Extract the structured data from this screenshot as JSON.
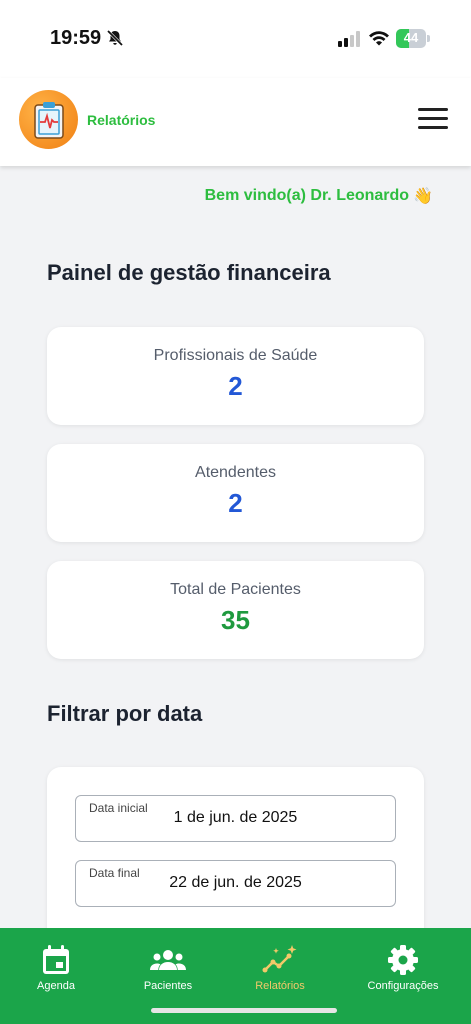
{
  "status_bar": {
    "time": "19:59",
    "battery": "44",
    "battery_level": 0.44
  },
  "header": {
    "title": "Relatórios"
  },
  "welcome": {
    "text": "Bem vindo(a) Dr. Leonardo",
    "emoji": "👋"
  },
  "dashboard": {
    "title": "Painel de gestão financeira",
    "stats": [
      {
        "label": "Profissionais de Saúde",
        "value": "2",
        "color": "#2358d6"
      },
      {
        "label": "Atendentes",
        "value": "2",
        "color": "#2358d6"
      },
      {
        "label": "Total de Pacientes",
        "value": "35",
        "color": "#1f9a3f"
      }
    ]
  },
  "filter": {
    "title": "Filtrar por data",
    "start_label": "Data inicial",
    "start_value": "1 de jun. de 2025",
    "end_label": "Data final",
    "end_value": "22 de jun. de 2025"
  },
  "nav": {
    "items": [
      {
        "label": "Agenda",
        "icon": "calendar-icon"
      },
      {
        "label": "Pacientes",
        "icon": "people-icon"
      },
      {
        "label": "Relatórios",
        "icon": "chart-sparkle-icon",
        "active": true
      },
      {
        "label": "Configurações",
        "icon": "gear-icon"
      }
    ]
  },
  "colors": {
    "accent_green": "#2dbd3f",
    "nav_background": "#1ba54a",
    "nav_active": "#f3c969",
    "stat_blue": "#2358d6",
    "stat_green": "#1f9a3f"
  }
}
